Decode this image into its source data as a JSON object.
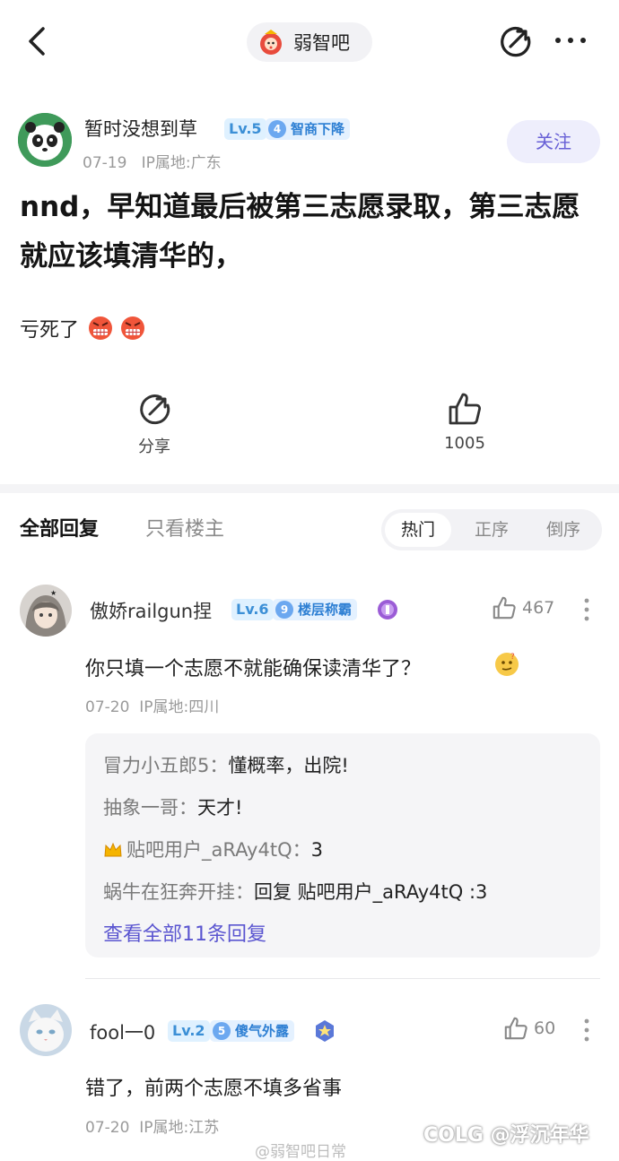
{
  "forum": {
    "name": "弱智吧"
  },
  "post": {
    "author": "暂时没想到草",
    "level": "Lv.5",
    "badge_num": "4",
    "badge_text": "智商下降",
    "date": "07-19",
    "ip": "IP属地:广东",
    "follow_label": "关注",
    "title": "nnd，早知道最后被第三志愿录取，第三志愿就应该填清华的，",
    "body": "亏死了",
    "share_label": "分享",
    "like_count": "1005"
  },
  "tabs": {
    "all": "全部回复",
    "op_only": "只看楼主"
  },
  "sort": [
    "热门",
    "正序",
    "倒序"
  ],
  "comments": [
    {
      "name": "傲娇railgun捏",
      "level": "Lv.6",
      "badge_num": "9",
      "badge_text": "楼层称霸",
      "likes": "467",
      "text": "你只填一个志愿不就能确保读清华了？",
      "date": "07-20",
      "ip": "IP属地:四川",
      "replies": [
        {
          "name": "冒力小五郎5：",
          "text": "懂概率，出院!"
        },
        {
          "name": "抽象一哥：",
          "text": "天才!"
        },
        {
          "name": "贴吧用户_aRAy4tQ：",
          "text": "3"
        },
        {
          "name": "蜗牛在狂奔开挂：",
          "text": "回复 贴吧用户_aRAy4tQ :3"
        }
      ],
      "view_all": "查看全部11条回复"
    },
    {
      "name": "fool一0",
      "level": "Lv.2",
      "badge_num": "5",
      "badge_text": "傻气外露",
      "likes": "60",
      "text": "错了，前两个志愿不填多省事",
      "date": "07-20",
      "ip": "IP属地:江苏"
    }
  ],
  "watermarks": {
    "weibo": "@弱智吧日常",
    "corner": "COLG @浮沉年华"
  },
  "colors": {
    "accent": "#6860d6",
    "badge_blue": "#2d7fd3",
    "divider": "#f4f4f6"
  }
}
